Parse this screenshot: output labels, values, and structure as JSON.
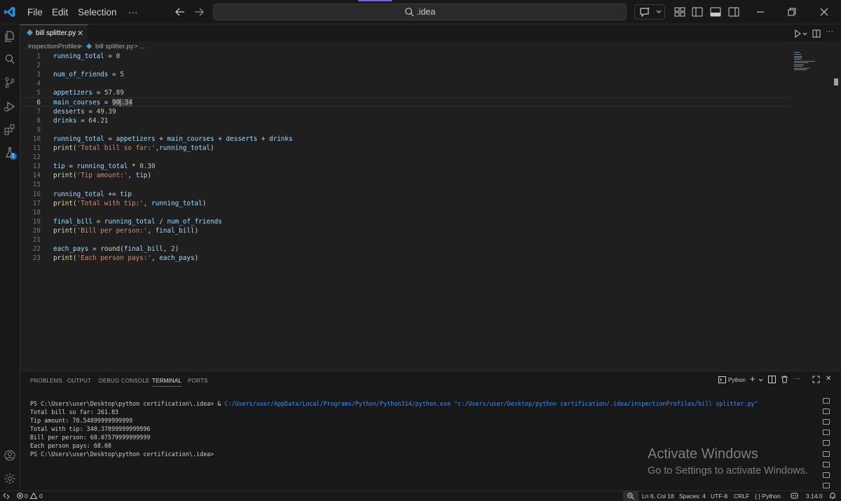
{
  "menu": {
    "file": "File",
    "edit": "Edit",
    "selection": "Selection",
    "more": "···"
  },
  "search": {
    "text": ".idea"
  },
  "tab": {
    "filename": "bill splitter.py",
    "close": "✕"
  },
  "breadcrumb": {
    "folder": "inspectionProfiles",
    "sep1": ">",
    "file": "bill splitter.py",
    "sep2": "> ..."
  },
  "editor": {
    "active_line": 6,
    "lines": [
      {
        "n": "1",
        "code": "running_total = 0"
      },
      {
        "n": "2",
        "code": ""
      },
      {
        "n": "3",
        "code": "num_of_friends = 5"
      },
      {
        "n": "4",
        "code": ""
      },
      {
        "n": "5",
        "code": "appetizers = 57.89"
      },
      {
        "n": "6",
        "code": "main_courses = 90.34"
      },
      {
        "n": "7",
        "code": "desserts = 49.39"
      },
      {
        "n": "8",
        "code": "drinks = 64.21"
      },
      {
        "n": "9",
        "code": ""
      },
      {
        "n": "10",
        "code": "running_total = appetizers + main_courses + desserts + drinks"
      },
      {
        "n": "11",
        "code": "print('Total bill so far:',running_total)"
      },
      {
        "n": "12",
        "code": ""
      },
      {
        "n": "13",
        "code": "tip = running_total * 0.30"
      },
      {
        "n": "14",
        "code": "print('Tip amount:', tip)"
      },
      {
        "n": "15",
        "code": ""
      },
      {
        "n": "16",
        "code": "running_total += tip"
      },
      {
        "n": "17",
        "code": "print('Total with tip:', running_total)"
      },
      {
        "n": "18",
        "code": ""
      },
      {
        "n": "19",
        "code": "final_bill = running_total / num_of_friends"
      },
      {
        "n": "20",
        "code": "print('Bill per person:', final_bill)"
      },
      {
        "n": "21",
        "code": ""
      },
      {
        "n": "22",
        "code": "each_pays = round(final_bill, 2)"
      },
      {
        "n": "23",
        "code": "print('Each person pays:', each_pays)"
      }
    ]
  },
  "panel": {
    "tabs": [
      "PROBLEMS",
      "OUTPUT",
      "DEBUG CONSOLE",
      "TERMINAL",
      "PORTS"
    ],
    "active_tab": "TERMINAL",
    "profile": "Python",
    "add": "+",
    "more": "···",
    "close": "✕"
  },
  "terminal": {
    "command_prompt": "PS C:\\Users\\user\\Desktop\\python certification\\.idea> & ",
    "command_exe": "C:/Users/user/AppData/Local/Programs/Python/Python314/python.exe",
    "command_arg": " \"c:/Users/user/Desktop/python certification/.idea/inspectionProfiles/bill splitter.py\"",
    "output": [
      "Total bill so far: 261.83",
      "Tip amount: 78.54899999999999",
      "Total with tip: 340.37899999999996",
      "Bill per person: 68.07579999999999",
      "Each person pays: 68.08",
      "PS C:\\Users\\user\\Desktop\\python certification\\.idea>"
    ]
  },
  "watermark": {
    "title": "Activate Windows",
    "subtitle": "Go to Settings to activate Windows."
  },
  "status": {
    "errors": "0",
    "warnings": "0",
    "position": "Ln 6, Col 18",
    "spaces": "Spaces: 4",
    "encoding": "UTF-8",
    "eol": "CRLF",
    "language": "{ } Python",
    "python_version": "3.14.0"
  },
  "colors": {
    "accent": "#0078d4",
    "python_blue": "#519aba",
    "variable": "#9cdcfe",
    "number": "#b5cea8",
    "string": "#ce9178",
    "function": "#dcdcaa"
  }
}
